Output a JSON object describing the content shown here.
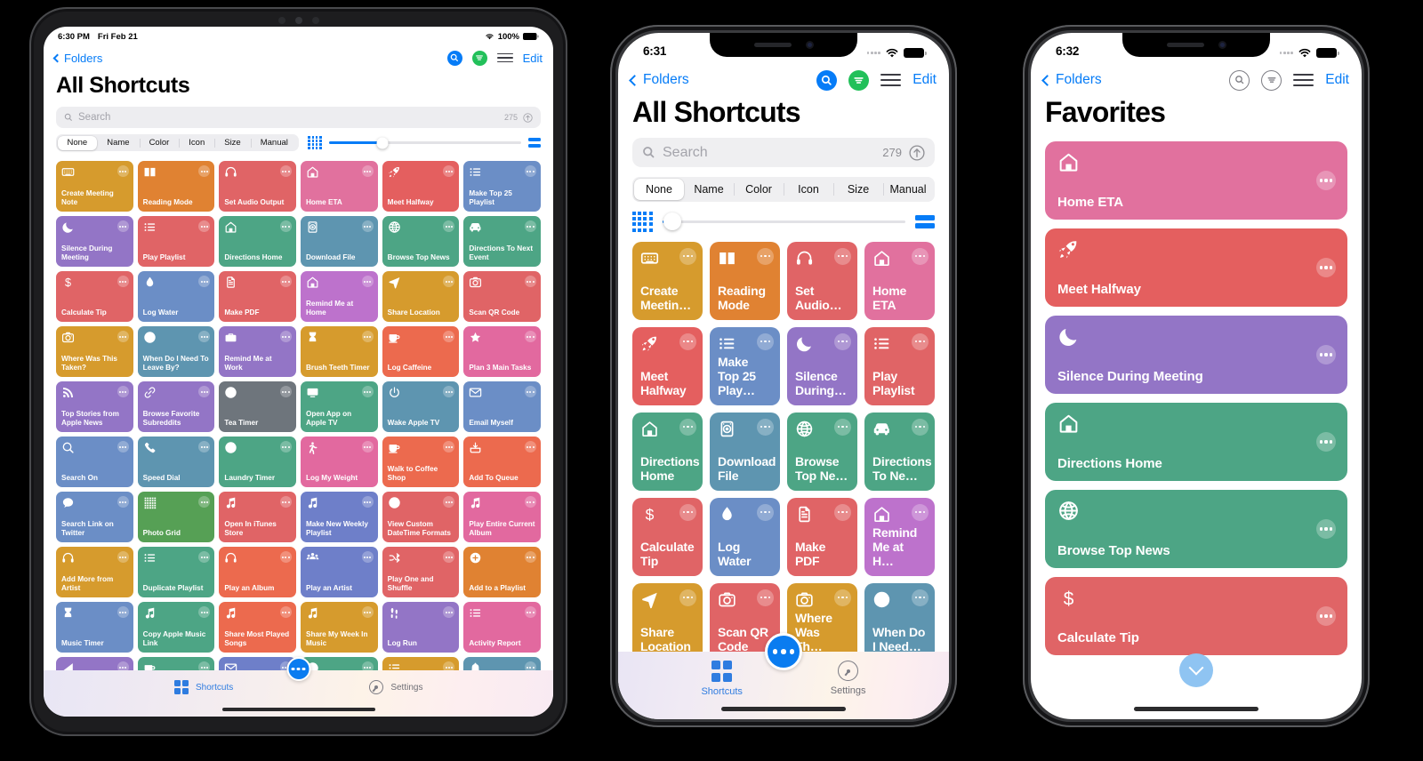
{
  "colors": {
    "blue_accent": "#067cf7",
    "green_accent": "#22c05a",
    "gold": "#d69b2d",
    "orange": "#e08232",
    "red": "#dd5f62",
    "pink": "#dd6b95",
    "rocket_red": "#e05a5a",
    "steel_blue": "#6b8ec6",
    "purple": "#9375c6",
    "teal_green": "#4da585",
    "teal_blue": "#5e95b0",
    "gray": "#6e757c",
    "grass_green": "#56a055",
    "indigo": "#6e7fc9",
    "deep_pink": "#e2699f",
    "coral": "#ec6a4e"
  },
  "ipad": {
    "status": {
      "time": "6:30 PM",
      "date": "Fri Feb 21",
      "battery": "100%"
    },
    "nav": {
      "back_label": "Folders",
      "edit_label": "Edit"
    },
    "title": "All Shortcuts",
    "search": {
      "placeholder": "Search",
      "count": "275"
    },
    "segments": [
      "None",
      "Name",
      "Color",
      "Icon",
      "Size",
      "Manual"
    ],
    "segment_active": "None",
    "tabs": [
      {
        "label": "Shortcuts",
        "active": true
      },
      {
        "label": "Settings",
        "active": false
      }
    ],
    "shortcuts": [
      {
        "name": "Create Meeting Note",
        "icon": "keyboard",
        "color": "#d69b2d"
      },
      {
        "name": "Reading Mode",
        "icon": "book",
        "color": "#e08232"
      },
      {
        "name": "Set Audio Output",
        "icon": "headphones",
        "color": "#e06466"
      },
      {
        "name": "Home ETA",
        "icon": "house",
        "color": "#e1719e"
      },
      {
        "name": "Meet Halfway",
        "icon": "rocket",
        "color": "#e45f5f"
      },
      {
        "name": "Make Top 25 Playlist",
        "icon": "list",
        "color": "#6b8ec6"
      },
      {
        "name": "Silence During Meeting",
        "icon": "moon",
        "color": "#9375c6"
      },
      {
        "name": "Play Playlist",
        "icon": "list",
        "color": "#e06466"
      },
      {
        "name": "Directions Home",
        "icon": "house",
        "color": "#4da585"
      },
      {
        "name": "Download File",
        "icon": "drive",
        "color": "#5e95b0"
      },
      {
        "name": "Browse Top News",
        "icon": "globe",
        "color": "#4da585"
      },
      {
        "name": "Directions To Next Event",
        "icon": "car",
        "color": "#4da585"
      },
      {
        "name": "Calculate Tip",
        "icon": "dollar",
        "color": "#e06466"
      },
      {
        "name": "Log Water",
        "icon": "drop",
        "color": "#6b8ec6"
      },
      {
        "name": "Make PDF",
        "icon": "doc",
        "color": "#e06466"
      },
      {
        "name": "Remind Me at Home",
        "icon": "house",
        "color": "#bd72cc"
      },
      {
        "name": "Share Location",
        "icon": "arrow",
        "color": "#d69b2d"
      },
      {
        "name": "Scan QR Code",
        "icon": "camera",
        "color": "#e06466"
      },
      {
        "name": "Where Was This Taken?",
        "icon": "camera",
        "color": "#d69b2d"
      },
      {
        "name": "When Do I Need To Leave By?",
        "icon": "clock",
        "color": "#5e95b0"
      },
      {
        "name": "Remind Me at Work",
        "icon": "briefcase",
        "color": "#9375c6"
      },
      {
        "name": "Brush Teeth Timer",
        "icon": "hourglass",
        "color": "#d69b2d"
      },
      {
        "name": "Log Caffeine",
        "icon": "cup",
        "color": "#ec6a4e"
      },
      {
        "name": "Plan 3 Main Tasks",
        "icon": "star",
        "color": "#e2699f"
      },
      {
        "name": "Top Stories from Apple News",
        "icon": "rss",
        "color": "#9375c6"
      },
      {
        "name": "Browse Favorite Subreddits",
        "icon": "link",
        "color": "#9375c6"
      },
      {
        "name": "Tea Timer",
        "icon": "clock",
        "color": "#6e757c"
      },
      {
        "name": "Open App on Apple TV",
        "icon": "tv",
        "color": "#4da585"
      },
      {
        "name": "Wake Apple TV",
        "icon": "power",
        "color": "#5e95b0"
      },
      {
        "name": "Email Myself",
        "icon": "envelope",
        "color": "#6b8ec6"
      },
      {
        "name": "Search On",
        "icon": "search",
        "color": "#6b8ec6"
      },
      {
        "name": "Speed Dial",
        "icon": "phone",
        "color": "#5e95b0"
      },
      {
        "name": "Laundry Timer",
        "icon": "clock",
        "color": "#4da585"
      },
      {
        "name": "Log My Weight",
        "icon": "person",
        "color": "#e2699f"
      },
      {
        "name": "Walk to Coffee Shop",
        "icon": "cup",
        "color": "#ec6a4e"
      },
      {
        "name": "Add To Queue",
        "icon": "tray",
        "color": "#ec6a4e"
      },
      {
        "name": "Search Link on Twitter",
        "icon": "bubble",
        "color": "#6b8ec6"
      },
      {
        "name": "Photo Grid",
        "icon": "griddots",
        "color": "#56a055"
      },
      {
        "name": "Open In iTunes Store",
        "icon": "note",
        "color": "#e06466"
      },
      {
        "name": "Make New Weekly Playlist",
        "icon": "note",
        "color": "#6e7fc9"
      },
      {
        "name": "View Custom DateTime Formats",
        "icon": "clock",
        "color": "#e06466"
      },
      {
        "name": "Play Entire Current Album",
        "icon": "note",
        "color": "#e2699f"
      },
      {
        "name": "Add More from Artist",
        "icon": "headphones",
        "color": "#d69b2d"
      },
      {
        "name": "Duplicate Playlist",
        "icon": "list",
        "color": "#4da585"
      },
      {
        "name": "Play an Album",
        "icon": "headphones",
        "color": "#ec6a4e"
      },
      {
        "name": "Play an Artist",
        "icon": "people",
        "color": "#6e7fc9"
      },
      {
        "name": "Play One and Shuffle",
        "icon": "shuffle",
        "color": "#e06466"
      },
      {
        "name": "Add to a Playlist",
        "icon": "plus",
        "color": "#e08232"
      },
      {
        "name": "Music Timer",
        "icon": "hourglass",
        "color": "#6b8ec6"
      },
      {
        "name": "Copy Apple Music Link",
        "icon": "note",
        "color": "#4da585"
      },
      {
        "name": "Share Most Played Songs",
        "icon": "note",
        "color": "#ec6a4e"
      },
      {
        "name": "Share My Week In Music",
        "icon": "note",
        "color": "#d69b2d"
      },
      {
        "name": "Log Run",
        "icon": "footprints",
        "color": "#9375c6"
      },
      {
        "name": "Activity Report",
        "icon": "list",
        "color": "#e2699f"
      },
      {
        "name": "",
        "icon": "chart",
        "color": "#9375c6"
      },
      {
        "name": "",
        "icon": "cup",
        "color": "#4da585"
      },
      {
        "name": "",
        "icon": "envelope",
        "color": "#6e7fc9"
      },
      {
        "name": "",
        "icon": "clock",
        "color": "#4da585"
      },
      {
        "name": "",
        "icon": "list",
        "color": "#d69b2d"
      },
      {
        "name": "",
        "icon": "bell",
        "color": "#5e95b0"
      }
    ]
  },
  "iphone_all": {
    "status": {
      "time": "6:31"
    },
    "nav": {
      "back_label": "Folders",
      "edit_label": "Edit"
    },
    "title": "All Shortcuts",
    "search": {
      "placeholder": "Search",
      "count": "279"
    },
    "segments": [
      "None",
      "Name",
      "Color",
      "Icon",
      "Size",
      "Manual"
    ],
    "segment_active": "None",
    "tabs": [
      {
        "label": "Shortcuts",
        "active": true
      },
      {
        "label": "Settings",
        "active": false
      }
    ],
    "shortcuts": [
      {
        "name": "Create Meetin…",
        "icon": "keyboard",
        "color": "#d69b2d"
      },
      {
        "name": "Reading Mode",
        "icon": "book",
        "color": "#e08232"
      },
      {
        "name": "Set Audio…",
        "icon": "headphones",
        "color": "#e06466"
      },
      {
        "name": "Home ETA",
        "icon": "house",
        "color": "#e1719e"
      },
      {
        "name": "Meet Halfway",
        "icon": "rocket",
        "color": "#e45f5f"
      },
      {
        "name": "Make Top 25 Play…",
        "icon": "list",
        "color": "#6b8ec6"
      },
      {
        "name": "Silence During…",
        "icon": "moon",
        "color": "#9375c6"
      },
      {
        "name": "Play Playlist",
        "icon": "list",
        "color": "#e06466"
      },
      {
        "name": "Directions Home",
        "icon": "house",
        "color": "#4da585"
      },
      {
        "name": "Download File",
        "icon": "drive",
        "color": "#5e95b0"
      },
      {
        "name": "Browse Top Ne…",
        "icon": "globe",
        "color": "#4da585"
      },
      {
        "name": "Directions To Ne…",
        "icon": "car",
        "color": "#4da585"
      },
      {
        "name": "Calculate Tip",
        "icon": "dollar",
        "color": "#e06466"
      },
      {
        "name": "Log Water",
        "icon": "drop",
        "color": "#6b8ec6"
      },
      {
        "name": "Make PDF",
        "icon": "doc",
        "color": "#e06466"
      },
      {
        "name": "Remind Me at H…",
        "icon": "house",
        "color": "#bd72cc"
      },
      {
        "name": "Share Location",
        "icon": "arrow",
        "color": "#d69b2d"
      },
      {
        "name": "Scan QR Code",
        "icon": "camera",
        "color": "#e06466"
      },
      {
        "name": "Where Was Th…",
        "icon": "camera",
        "color": "#d69b2d"
      },
      {
        "name": "When Do I Need…",
        "icon": "clock",
        "color": "#5e95b0"
      }
    ]
  },
  "iphone_fav": {
    "status": {
      "time": "6:32"
    },
    "nav": {
      "back_label": "Folders",
      "edit_label": "Edit"
    },
    "title": "Favorites",
    "shortcuts": [
      {
        "name": "Home ETA",
        "icon": "house",
        "color": "#e1719e"
      },
      {
        "name": "Meet Halfway",
        "icon": "rocket",
        "color": "#e45f5f"
      },
      {
        "name": "Silence During Meeting",
        "icon": "moon",
        "color": "#9375c6"
      },
      {
        "name": "Directions Home",
        "icon": "house",
        "color": "#4da585"
      },
      {
        "name": "Browse Top News",
        "icon": "globe",
        "color": "#4da585"
      },
      {
        "name": "Calculate Tip",
        "icon": "dollar",
        "color": "#e06466"
      }
    ]
  }
}
